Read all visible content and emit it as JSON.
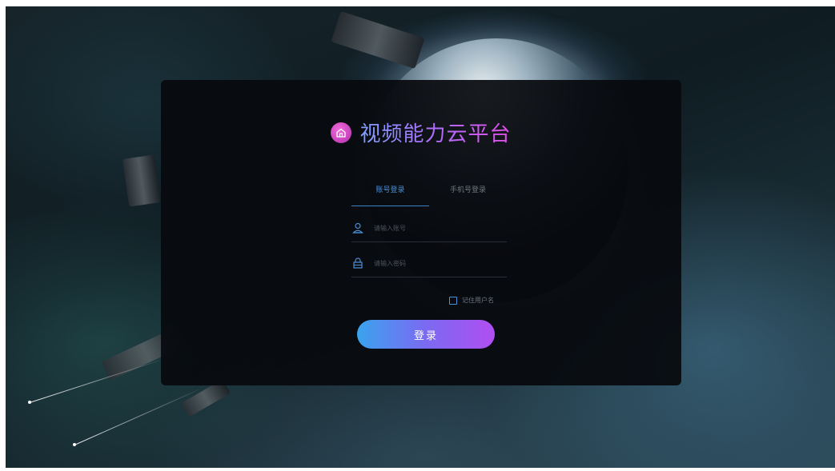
{
  "brand": {
    "title": "视频能力云平台",
    "icon": "home-icon",
    "gradient": [
      "#7fa0ff",
      "#b06cff",
      "#e24ee6"
    ]
  },
  "tabs": [
    {
      "label": "账号登录",
      "active": true
    },
    {
      "label": "手机号登录",
      "active": false
    }
  ],
  "form": {
    "username": {
      "placeholder": "请输入账号",
      "icon": "user-icon",
      "value": ""
    },
    "password": {
      "placeholder": "请输入密码",
      "icon": "lock-icon",
      "value": ""
    },
    "remember": {
      "label": "记住用户名",
      "checked": false
    }
  },
  "login_button": {
    "label": "登录"
  },
  "colors": {
    "accent": "#4b8fd6",
    "panel": "#080a0e",
    "button_gradient": [
      "#3aa3ee",
      "#7b6af2",
      "#b14ef2"
    ]
  }
}
